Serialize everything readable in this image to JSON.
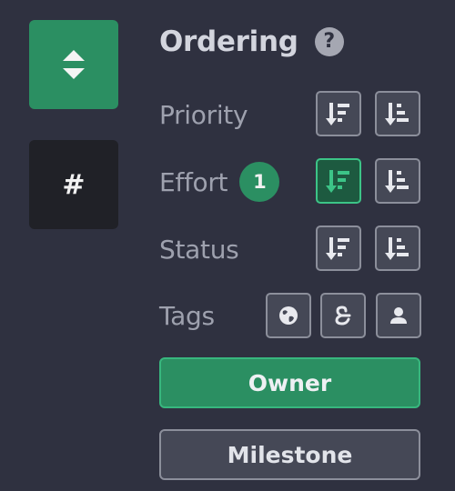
{
  "sidebar": {
    "hash_label": "#"
  },
  "ordering": {
    "title": "Ordering",
    "help_label": "?",
    "rows": [
      {
        "label": "Priority"
      },
      {
        "label": "Effort",
        "badge": "1"
      },
      {
        "label": "Status"
      },
      {
        "label": "Tags"
      }
    ],
    "owner_label": "Owner",
    "milestone_label": "Milestone"
  },
  "colors": {
    "accent": "#2b8f62",
    "accent_border": "#3cc487",
    "background": "#2f3140",
    "button_bg": "#454856",
    "dark_tile": "#202127"
  }
}
